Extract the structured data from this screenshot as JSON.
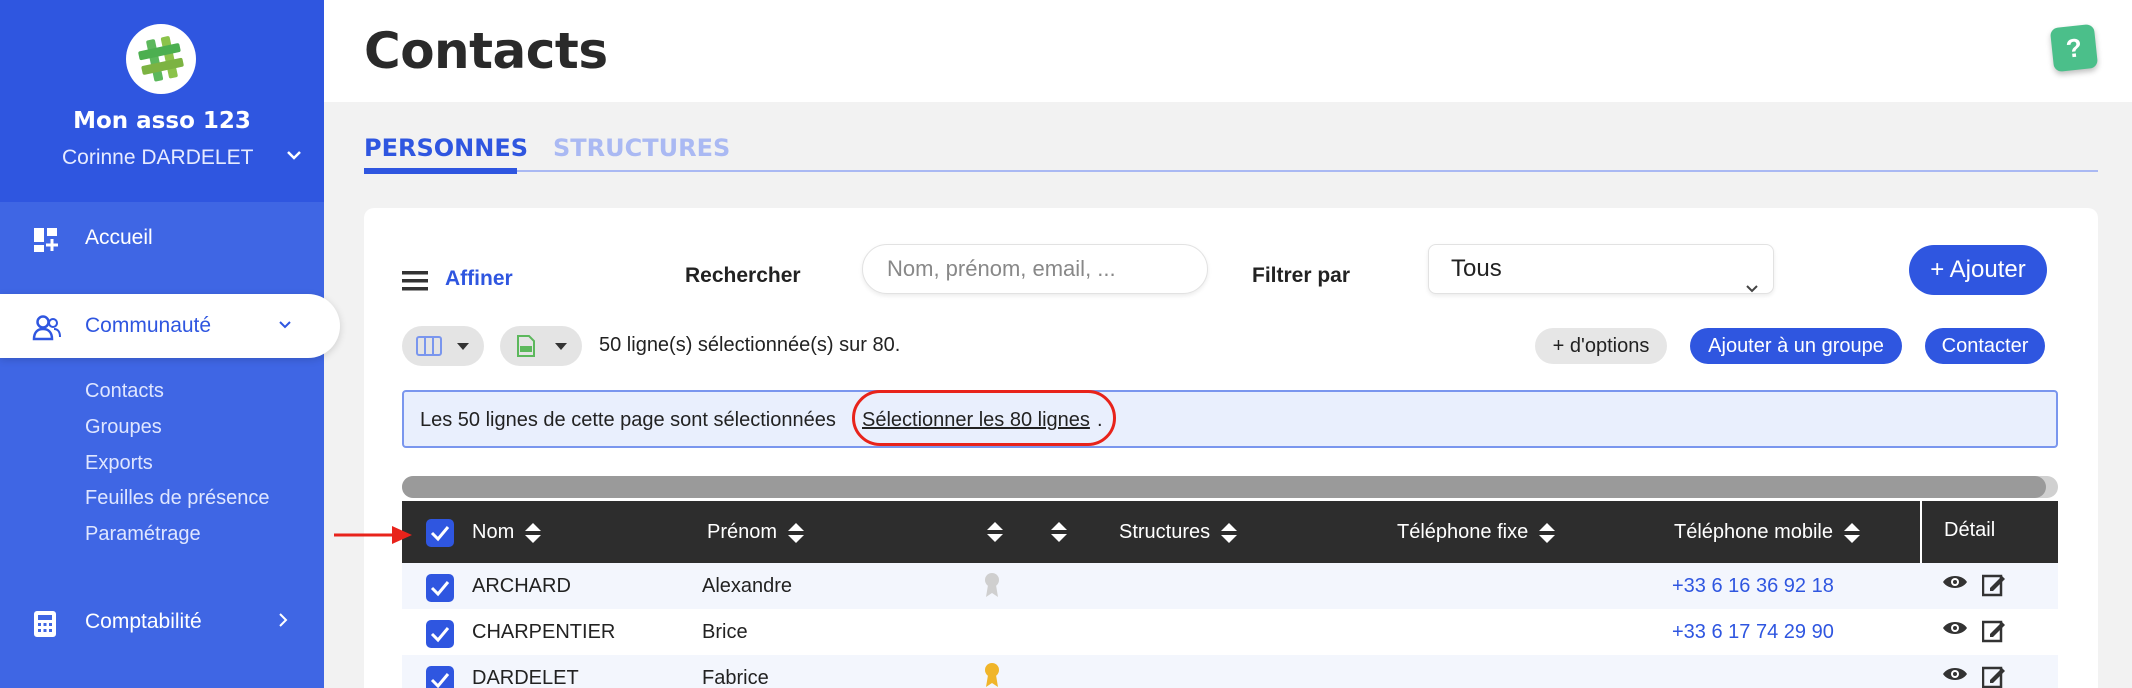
{
  "sidebar": {
    "org_name": "Mon asso 123",
    "user_name": "Corinne DARDELET",
    "nav": {
      "home": "Accueil",
      "community": "Communauté",
      "accounting": "Comptabilité"
    },
    "sub_items": [
      "Contacts",
      "Groupes",
      "Exports",
      "Feuilles de présence",
      "Paramétrage"
    ]
  },
  "header": {
    "title": "Contacts",
    "help": "?"
  },
  "tabs": {
    "people": "PERSONNES",
    "structures": "STRUCTURES"
  },
  "toolbar": {
    "refine": "Affiner",
    "search_label": "Rechercher",
    "search_placeholder": "Nom, prénom, email, ...",
    "filter_label": "Filtrer par",
    "filter_value": "Tous",
    "add_button": "+ Ajouter",
    "selection_count": "50 ligne(s) sélectionnée(s) sur 80.",
    "more_options": "+ d'options",
    "add_to_group": "Ajouter à un groupe",
    "contact": "Contacter"
  },
  "alert": {
    "text": "Les 50 lignes de cette page sont sélectionnées",
    "link": "Sélectionner les 80 lignes",
    "suffix": "."
  },
  "table": {
    "columns": {
      "nom": "Nom",
      "prenom": "Prénom",
      "structures": "Structures",
      "tel_fixe": "Téléphone fixe",
      "tel_mobile": "Téléphone mobile",
      "detail": "Détail"
    },
    "rows": [
      {
        "nom": "ARCHARD",
        "prenom": "Alexandre",
        "badge": "grey",
        "mobile": "+33 6 16 36 92 18"
      },
      {
        "nom": "CHARPENTIER",
        "prenom": "Brice",
        "badge": "none",
        "mobile": "+33 6 17 74 29 90"
      },
      {
        "nom": "DARDELET",
        "prenom": "Fabrice",
        "badge": "gold",
        "mobile": ""
      }
    ]
  },
  "colors": {
    "sidebar_bg": "#3f66e4",
    "accent": "#2f56e0",
    "table_header": "#2d2d2d",
    "highlight_red": "#e8231b",
    "help_green": "#4bbf8a"
  }
}
